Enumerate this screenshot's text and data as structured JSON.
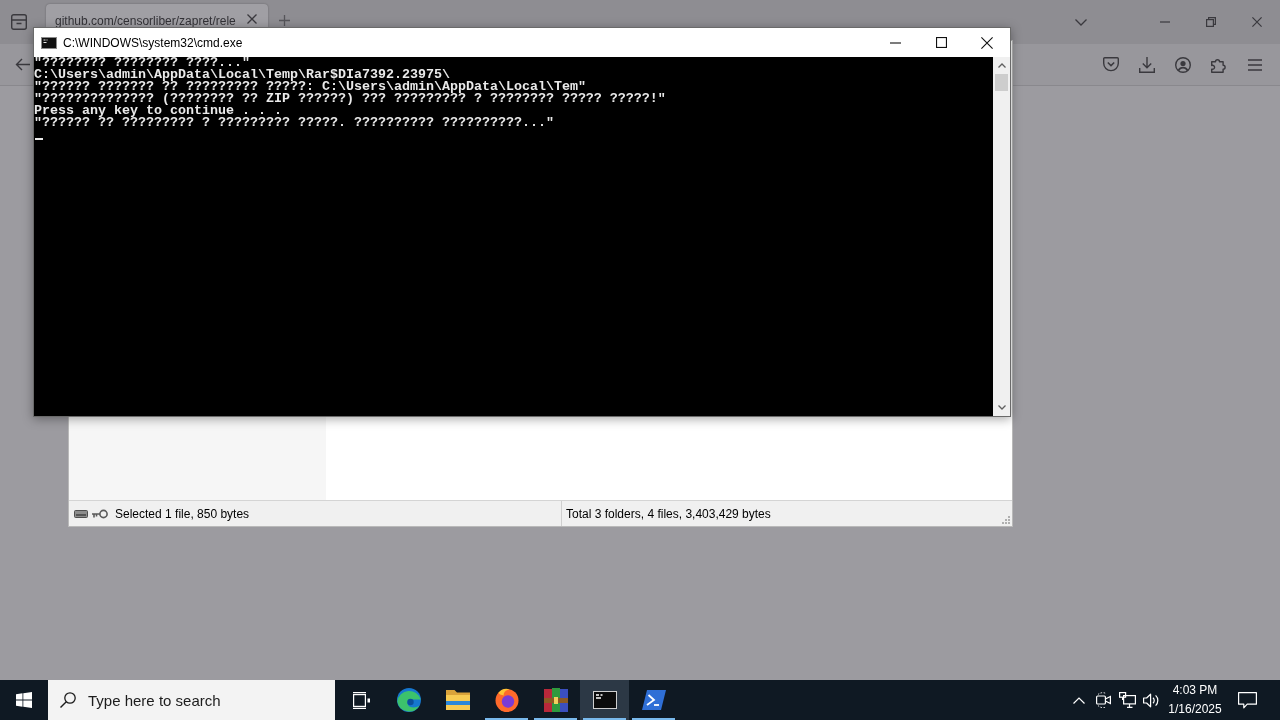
{
  "browser": {
    "tabs": [
      {
        "title": "github.com/censorliber/zapret/rele",
        "selected": true
      }
    ]
  },
  "console": {
    "title": "C:\\WINDOWS\\system32\\cmd.exe",
    "lines": [
      "\"???????? ???????? ????...\"",
      "C:\\Users\\admin\\AppData\\Local\\Temp\\Rar$DIa7392.23975\\",
      "\"?????? ??????? ?? ????????? ?????: C:\\Users\\admin\\AppData\\Local\\Tem\"",
      "\"?????????????? (???????? ?? ZIP ??????) ??? ????????? ? ???????? ????? ?????!\"",
      "Press any key to continue . . .",
      "\"?????? ?? ????????? ? ????????? ?????. ?????????? ??????????...\""
    ]
  },
  "archiver": {
    "status": {
      "selection": "Selected 1 file, 850 bytes",
      "totals": "Total 3 folders, 4 files, 3,403,429 bytes"
    }
  },
  "taskbar": {
    "search": {
      "placeholder": "Type here to search"
    },
    "apps": [
      {
        "kind": "edge",
        "running": false,
        "selected": false
      },
      {
        "kind": "explorer",
        "running": false,
        "selected": false
      },
      {
        "kind": "firefox",
        "running": true,
        "selected": false
      },
      {
        "kind": "winrar",
        "running": true,
        "selected": false
      },
      {
        "kind": "terminal",
        "running": true,
        "selected": true
      },
      {
        "kind": "powershell",
        "running": true,
        "selected": false
      }
    ],
    "clock": {
      "time": "4:03 PM",
      "date": "1/16/2025"
    }
  }
}
